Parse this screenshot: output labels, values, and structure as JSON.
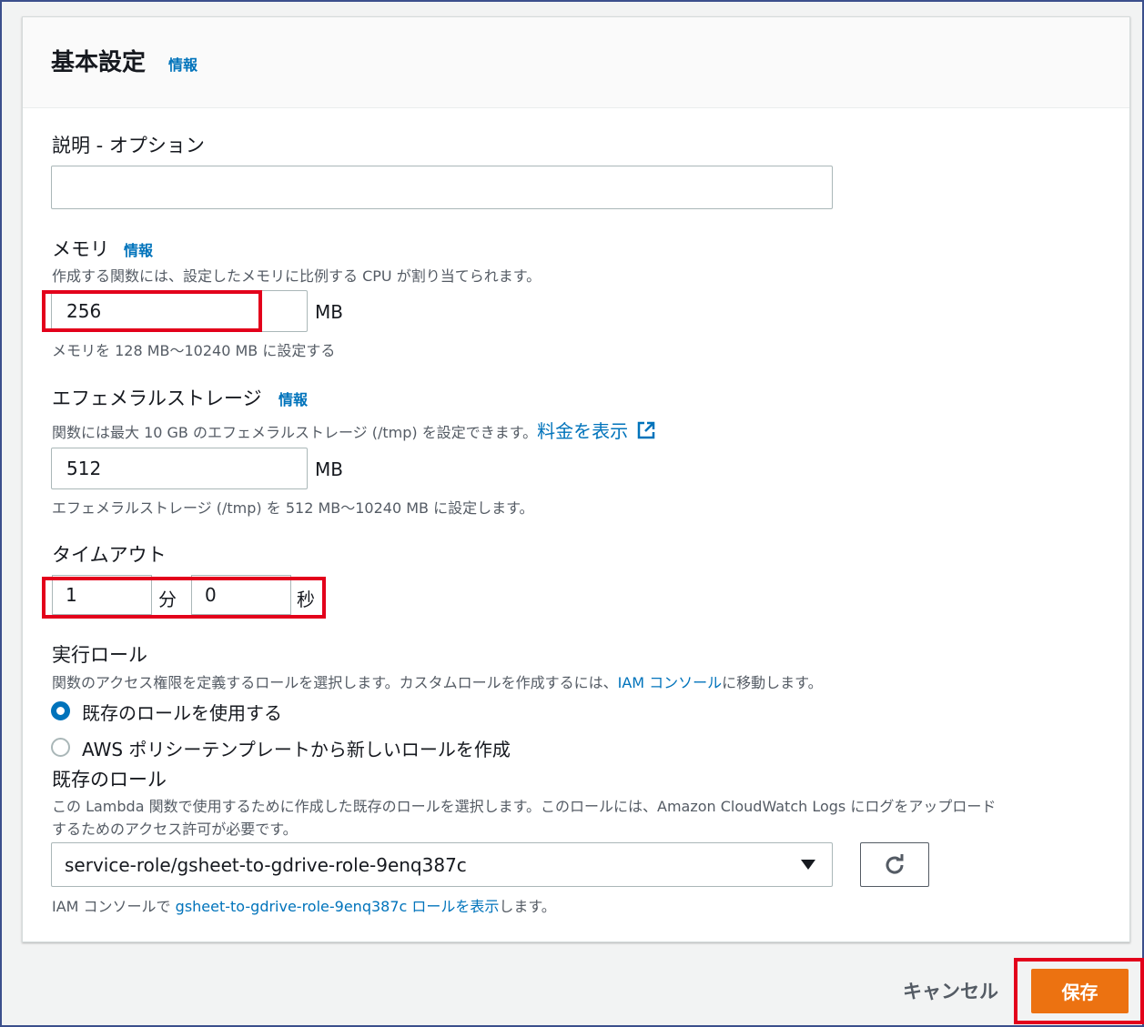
{
  "header": {
    "title": "基本設定",
    "info": "情報"
  },
  "description": {
    "label": "説明 - オプション",
    "value": "",
    "placeholder": ""
  },
  "memory": {
    "label": "メモリ",
    "info": "情報",
    "desc": "作成する関数には、設定したメモリに比例する CPU が割り当てられます。",
    "value": "256",
    "unit": "MB",
    "hint": "メモリを 128 MB～10240 MB に設定する"
  },
  "storage": {
    "label": "エフェメラルストレージ",
    "info": "情報",
    "desc": "関数には最大 10 GB のエフェメラルストレージ (/tmp) を設定できます。",
    "pricing_link": "料金を表示",
    "value": "512",
    "unit": "MB",
    "hint": "エフェメラルストレージ (/tmp) を 512 MB～10240 MB に設定します。"
  },
  "timeout": {
    "label": "タイムアウト",
    "minutes": "1",
    "minutes_unit": "分",
    "seconds": "0",
    "seconds_unit": "秒"
  },
  "role": {
    "label": "実行ロール",
    "desc_prefix": "関数のアクセス権限を定義するロールを選択します。カスタムロールを作成するには、",
    "desc_link": "IAM コンソール",
    "desc_suffix": "に移動します。",
    "option_existing": "既存のロールを使用する",
    "option_template": "AWS ポリシーテンプレートから新しいロールを作成"
  },
  "existing_role": {
    "label": "既存のロール",
    "desc_line1": "この Lambda 関数で使用するために作成した既存のロールを選択します。このロールには、Amazon CloudWatch Logs にログをアップロード",
    "desc_line2": "するためのアクセス許可が必要です。",
    "selected": "service-role/gsheet-to-gdrive-role-9enq387c",
    "footer_prefix": "IAM コンソールで ",
    "footer_link": "gsheet-to-gdrive-role-9enq387c ロールを表示",
    "footer_suffix": "します。"
  },
  "footer": {
    "cancel": "キャンセル",
    "save": "保存"
  },
  "colors": {
    "accent": "#0073bb",
    "save": "#ec7211",
    "highlight": "#e3001b"
  }
}
